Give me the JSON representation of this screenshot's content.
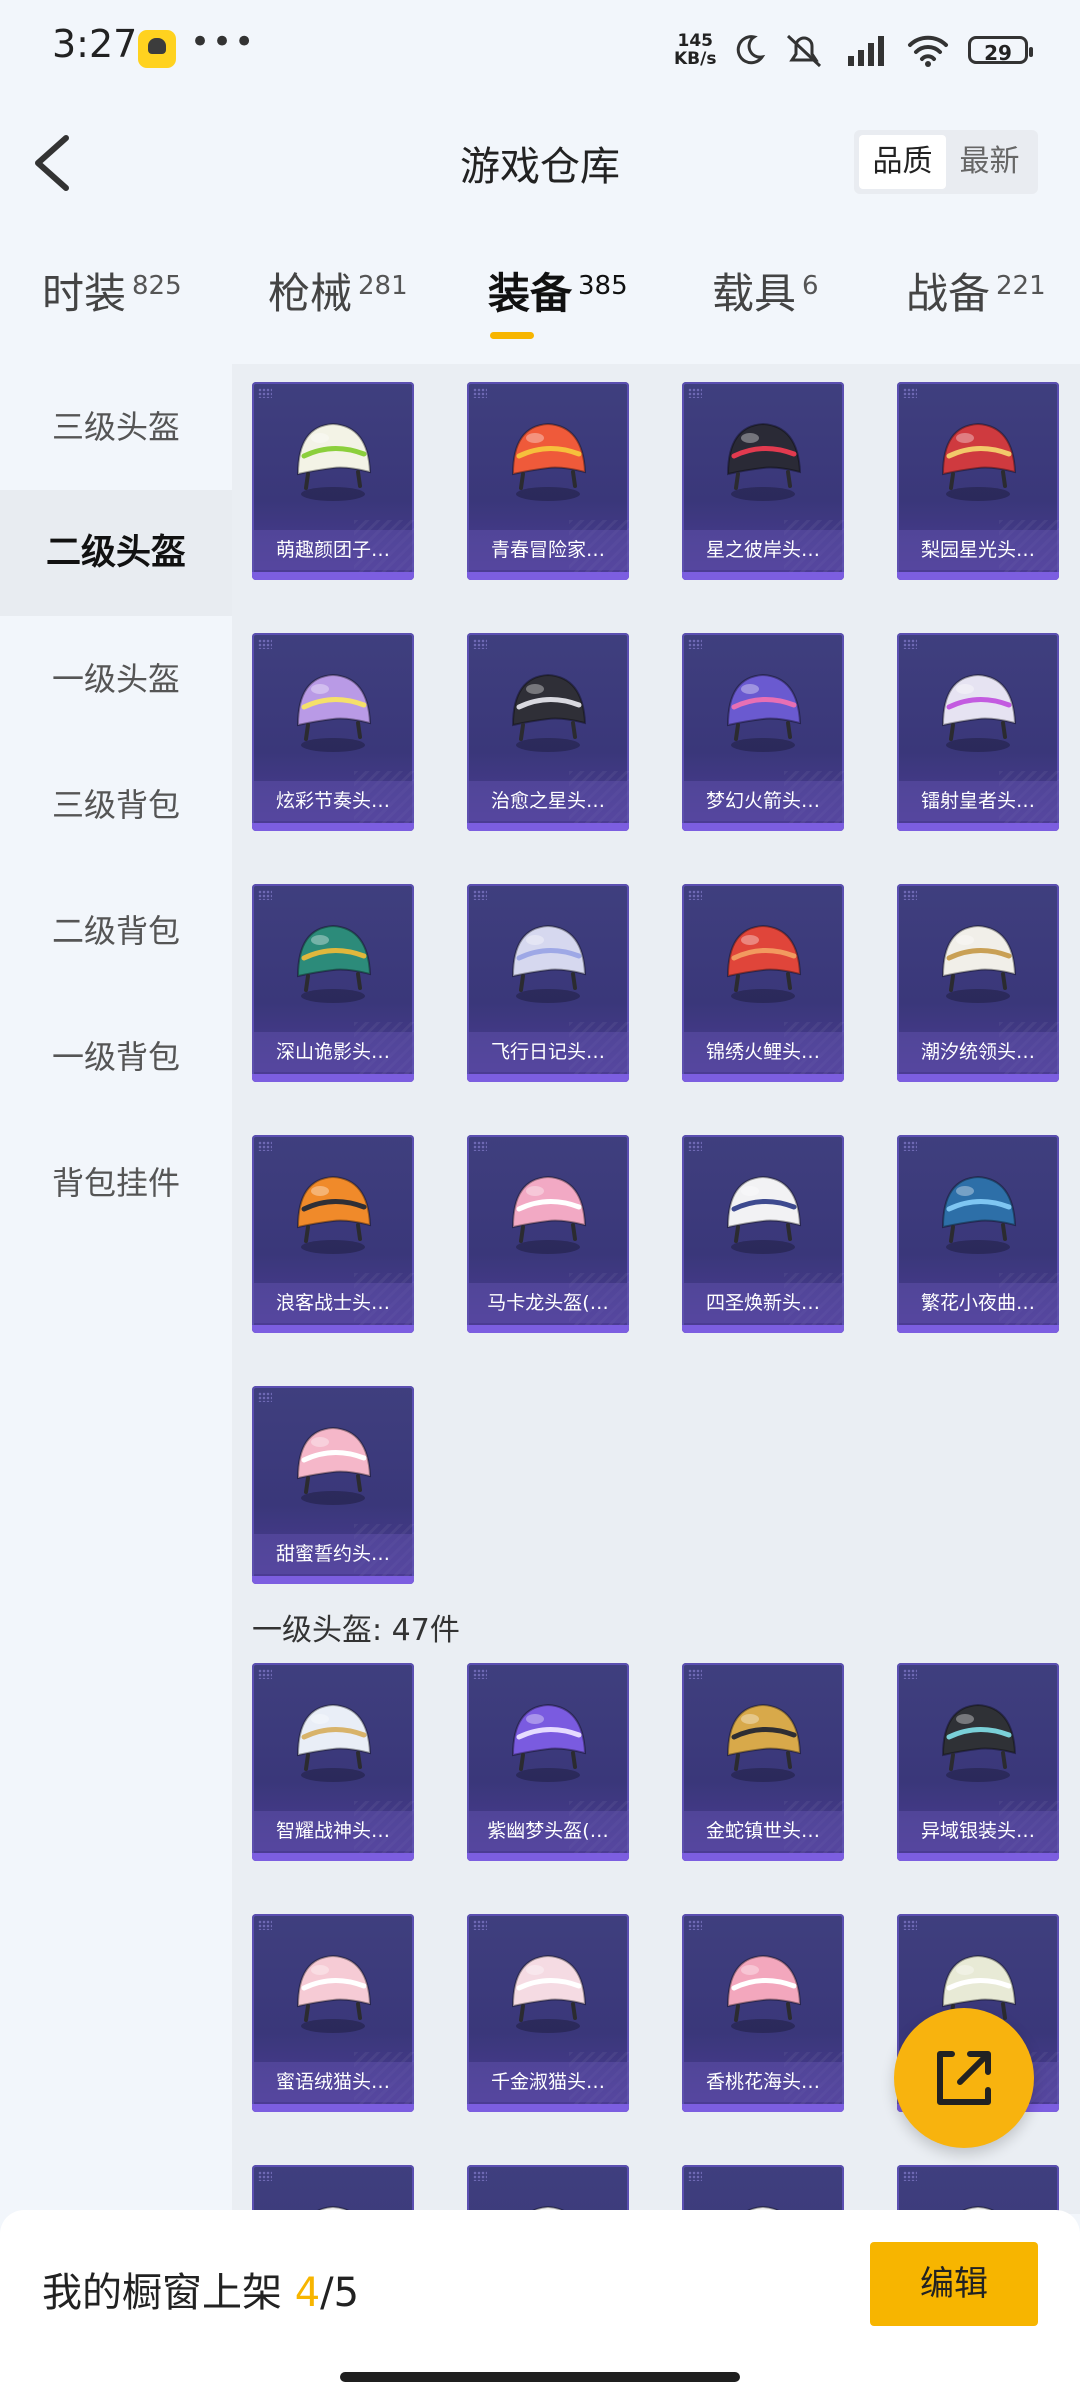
{
  "status_bar": {
    "time": "3:27",
    "dots": "•••",
    "net_speed_value": "145",
    "net_speed_unit": "KB/s",
    "battery": "29"
  },
  "header": {
    "title": "游戏仓库",
    "sort_options": [
      "品质",
      "最新"
    ]
  },
  "category_tabs": [
    {
      "label": "时装",
      "count": "825"
    },
    {
      "label": "枪械",
      "count": "281"
    },
    {
      "label": "装备",
      "count": "385"
    },
    {
      "label": "载具",
      "count": "6"
    },
    {
      "label": "战备",
      "count": "221"
    }
  ],
  "sidebar": {
    "items": [
      "三级头盔",
      "二级头盔",
      "一级头盔",
      "三级背包",
      "二级背包",
      "一级背包",
      "背包挂件"
    ]
  },
  "sections": [
    {
      "title": "",
      "items": [
        {
          "name": "萌趣颜团子…",
          "color": "#f3f3e6",
          "accent": "#8bcf3c"
        },
        {
          "name": "青春冒险家…",
          "color": "#ef5a3a",
          "accent": "#f6c03c"
        },
        {
          "name": "星之彼岸头…",
          "color": "#2a2a36",
          "accent": "#e23a4f"
        },
        {
          "name": "梨园星光头…",
          "color": "#cf3a3f",
          "accent": "#f2c96a"
        },
        {
          "name": "炫彩节奏头…",
          "color": "#b99ae6",
          "accent": "#f5e06a"
        },
        {
          "name": "治愈之星头…",
          "color": "#2f2f37",
          "accent": "#d9d9e0"
        },
        {
          "name": "梦幻火箭头…",
          "color": "#6a5ad0",
          "accent": "#e86fb4"
        },
        {
          "name": "镭射皇者头…",
          "color": "#e6e3f2",
          "accent": "#c35be0"
        },
        {
          "name": "深山诡影头…",
          "color": "#2c8b7a",
          "accent": "#e0b73c"
        },
        {
          "name": "飞行日记头…",
          "color": "#d6d8ef",
          "accent": "#9ea8e6"
        },
        {
          "name": "锦绣火鲤头…",
          "color": "#e0453a",
          "accent": "#f29a5f"
        },
        {
          "name": "潮汐统领头…",
          "color": "#f1efe9",
          "accent": "#c9a055"
        },
        {
          "name": "浪客战士头…",
          "color": "#f08a2a",
          "accent": "#2f2f36"
        },
        {
          "name": "马卡龙头盔(…",
          "color": "#f2a9c4",
          "accent": "#ffffff"
        },
        {
          "name": "四圣焕新头…",
          "color": "#f2f2f4",
          "accent": "#3d4a8f"
        },
        {
          "name": "繁花小夜曲…",
          "color": "#2d6fa8",
          "accent": "#7fc6f2"
        },
        {
          "name": "甜蜜誓约头…",
          "color": "#f5b7c9",
          "accent": "#ffffff"
        }
      ]
    },
    {
      "title": "一级头盔: 47件",
      "items": [
        {
          "name": "智耀战神头…",
          "color": "#e9eef7",
          "accent": "#d8b36a"
        },
        {
          "name": "紫幽梦头盔(…",
          "color": "#7a5be0",
          "accent": "#e6dcff"
        },
        {
          "name": "金蛇镇世头…",
          "color": "#d8a94a",
          "accent": "#2e2e33"
        },
        {
          "name": "异域银装头…",
          "color": "#2f3136",
          "accent": "#7ad0d8"
        },
        {
          "name": "蜜语绒猫头…",
          "color": "#f6cbd5",
          "accent": "#ffffff"
        },
        {
          "name": "千金淑猫头…",
          "color": "#f5dbe3",
          "accent": "#ffffff"
        },
        {
          "name": "香桃花海头…",
          "color": "#f3a7bd",
          "accent": "#ffffff"
        },
        {
          "name": "",
          "color": "#e8ead6",
          "accent": "#ffffff"
        },
        {
          "name": "",
          "color": "#f2f2f2",
          "accent": "#ffffff"
        },
        {
          "name": "",
          "color": "#f2f2f2",
          "accent": "#ffffff"
        },
        {
          "name": "",
          "color": "#f2f2f2",
          "accent": "#ffffff"
        },
        {
          "name": "",
          "color": "#f2f2f2",
          "accent": "#ffffff"
        }
      ]
    }
  ],
  "bottom_bar": {
    "label": "我的橱窗上架",
    "current": "4",
    "total": "/5",
    "edit_label": "编辑"
  },
  "colors": {
    "accent": "#f7b500",
    "card_bg": "#3c397c",
    "card_border": "#5b4fb1"
  }
}
